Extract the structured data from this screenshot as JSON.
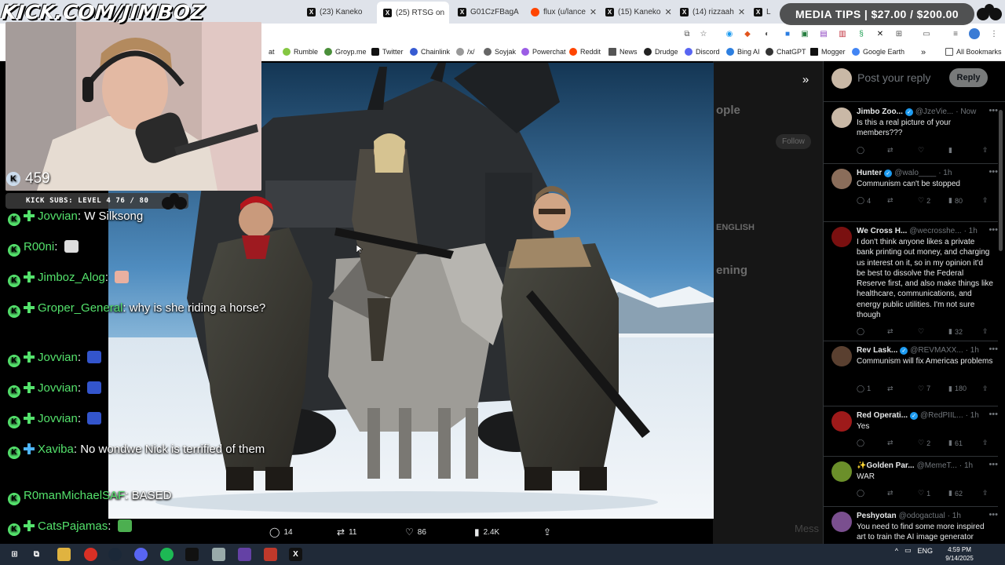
{
  "browser": {
    "tabs": [
      {
        "label": "(23) Kaneko",
        "icon": "x-logo"
      },
      {
        "label": "(25) RTSG on",
        "icon": "x-logo",
        "active": true
      },
      {
        "label": "G01CzFBagA",
        "icon": "x-logo"
      },
      {
        "label": "flux (u/lance",
        "icon": "reddit-logo"
      },
      {
        "label": "(15) Kaneko",
        "icon": "x-logo"
      },
      {
        "label": "(14) rizzaah",
        "icon": "x-logo"
      },
      {
        "label": "L",
        "icon": "x-logo"
      }
    ],
    "close_glyph": "✕",
    "bookmarks": [
      {
        "label": "at",
        "color": "#888"
      },
      {
        "label": "Rumble",
        "color": "#85c742"
      },
      {
        "label": "Groyp.me",
        "color": "#4a8f3a"
      },
      {
        "label": "Twitter",
        "color": "#111"
      },
      {
        "label": "Chainlink",
        "color": "#375bd2"
      },
      {
        "label": "/x/",
        "color": "#999"
      },
      {
        "label": "Soyjak",
        "color": "#666"
      },
      {
        "label": "Powerchat",
        "color": "#9b5de5"
      },
      {
        "label": "Reddit",
        "color": "#ff4500"
      },
      {
        "label": "News",
        "color": "#555"
      },
      {
        "label": "Drudge",
        "color": "#222"
      },
      {
        "label": "Discord",
        "color": "#5865f2"
      },
      {
        "label": "Bing AI",
        "color": "#2d7fe0"
      },
      {
        "label": "ChatGPT",
        "color": "#333"
      },
      {
        "label": "Mogger",
        "color": "#111"
      },
      {
        "label": "Google Earth",
        "color": "#4285f4"
      }
    ],
    "bookmarks_overflow": "»",
    "all_bookmarks": "All Bookmarks"
  },
  "overlay": {
    "channel_url": "KICK.COM/JIMBOZ",
    "viewer_count": "459",
    "subs_bar": "KICK SUBS: LEVEL 4  76 / 80",
    "media_tips": "MEDIA TIPS | $27.00 / $200.00"
  },
  "chat": [
    {
      "user": "Jovvian",
      "text": "W Silksong",
      "badge": "#54e26c"
    },
    {
      "user": "R00ni",
      "text": "",
      "badge": null,
      "emote": "#ddd"
    },
    {
      "user": "Jimboz_Alog",
      "text": "",
      "badge": "#54e26c",
      "emote": "#e8b0a0"
    },
    {
      "user": "Groper_General",
      "text": "why is she riding a horse?",
      "badge": "#54e26c"
    },
    {
      "user": "Jovvian",
      "text": "",
      "badge": "#54e26c",
      "emote": "#3355cc"
    },
    {
      "user": "Jovvian",
      "text": "",
      "badge": "#54e26c",
      "emote": "#3355cc"
    },
    {
      "user": "Jovvian",
      "text": "",
      "badge": "#54e26c",
      "emote": "#3355cc"
    },
    {
      "user": "Xaviba",
      "text": "No wondwe Nick is terrified of them",
      "badge": "#4fb6ff"
    },
    {
      "user": "R0manMichaelSAF",
      "text": "BASED",
      "badge": null
    },
    {
      "user": "CatsPajamas",
      "text": "",
      "badge": "#54e26c",
      "emote": "#4caf50"
    }
  ],
  "post_actions": {
    "replies": "14",
    "reposts": "11",
    "likes": "86",
    "views": "2.4K"
  },
  "reply_panel": {
    "placeholder": "Post your reply",
    "reply_button": "Reply",
    "replies": [
      {
        "name": "Jimbo Zoo...",
        "verified": true,
        "handle": "@JzeVie...",
        "time": "· Now",
        "text": "Is this a real picture of your members???",
        "counts": {
          "replies": "",
          "reposts": "",
          "likes": "",
          "views": ""
        },
        "avatar": "#c9b8a6"
      },
      {
        "name": "Hunter",
        "verified": true,
        "handle": "@walo____",
        "time": "· 1h",
        "text": "Communism can't be stopped",
        "counts": {
          "replies": "4",
          "reposts": "",
          "likes": "2",
          "views": "80"
        },
        "avatar": "#8a6d5a"
      },
      {
        "name": "We Cross H...",
        "verified": false,
        "handle": "@wecrosshe...",
        "time": "· 1h",
        "text": "I don't think anyone likes a private bank printing out money, and charging us interest on it, so in my opinion it'd be best to dissolve the Federal Reserve first, and also make things like healthcare, communications, and energy public utilities. I'm not sure though",
        "counts": {
          "replies": "",
          "reposts": "",
          "likes": "",
          "views": "32"
        },
        "avatar": "#7a1010"
      },
      {
        "name": "Rev Lask...",
        "verified": true,
        "handle": "@REVMAXX...",
        "time": "· 1h",
        "text": "Communism will fix Americas problems",
        "counts": {
          "replies": "1",
          "reposts": "",
          "likes": "7",
          "views": "180"
        },
        "avatar": "#5a4030"
      },
      {
        "name": "Red Operati...",
        "verified": true,
        "handle": "@RedPIIL...",
        "time": "· 1h",
        "text": "Yes",
        "counts": {
          "replies": "",
          "reposts": "",
          "likes": "2",
          "views": "61"
        },
        "avatar": "#9e1a1a"
      },
      {
        "name": "✨Golden Par...",
        "verified": false,
        "handle": "@MemeT...",
        "time": "· 1h",
        "text": "WAR",
        "counts": {
          "replies": "",
          "reposts": "",
          "likes": "1",
          "views": "62"
        },
        "avatar": "#6b8f2a"
      },
      {
        "name": "Peshyotan",
        "verified": false,
        "handle": "@odogactual",
        "time": "· 1h",
        "text": "You need to find some more inspired art to train the AI image generator",
        "counts": {
          "replies": "",
          "reposts": "",
          "likes": "",
          "views": ""
        },
        "avatar": "#7a4f8f"
      }
    ]
  },
  "backdrop": {
    "ghost_1": "ople",
    "ghost_2": "Follow",
    "ghost_3": "ENGLISH",
    "ghost_4": "ening",
    "ghost_5": "Mess"
  },
  "taskbar": {
    "tray_lang": "ENG",
    "time": "4:59 PM",
    "date": "9/14/2025"
  },
  "colors": {
    "x_background": "#000000",
    "kick_green": "#54e26c",
    "x_blue": "#1d9bf0"
  }
}
